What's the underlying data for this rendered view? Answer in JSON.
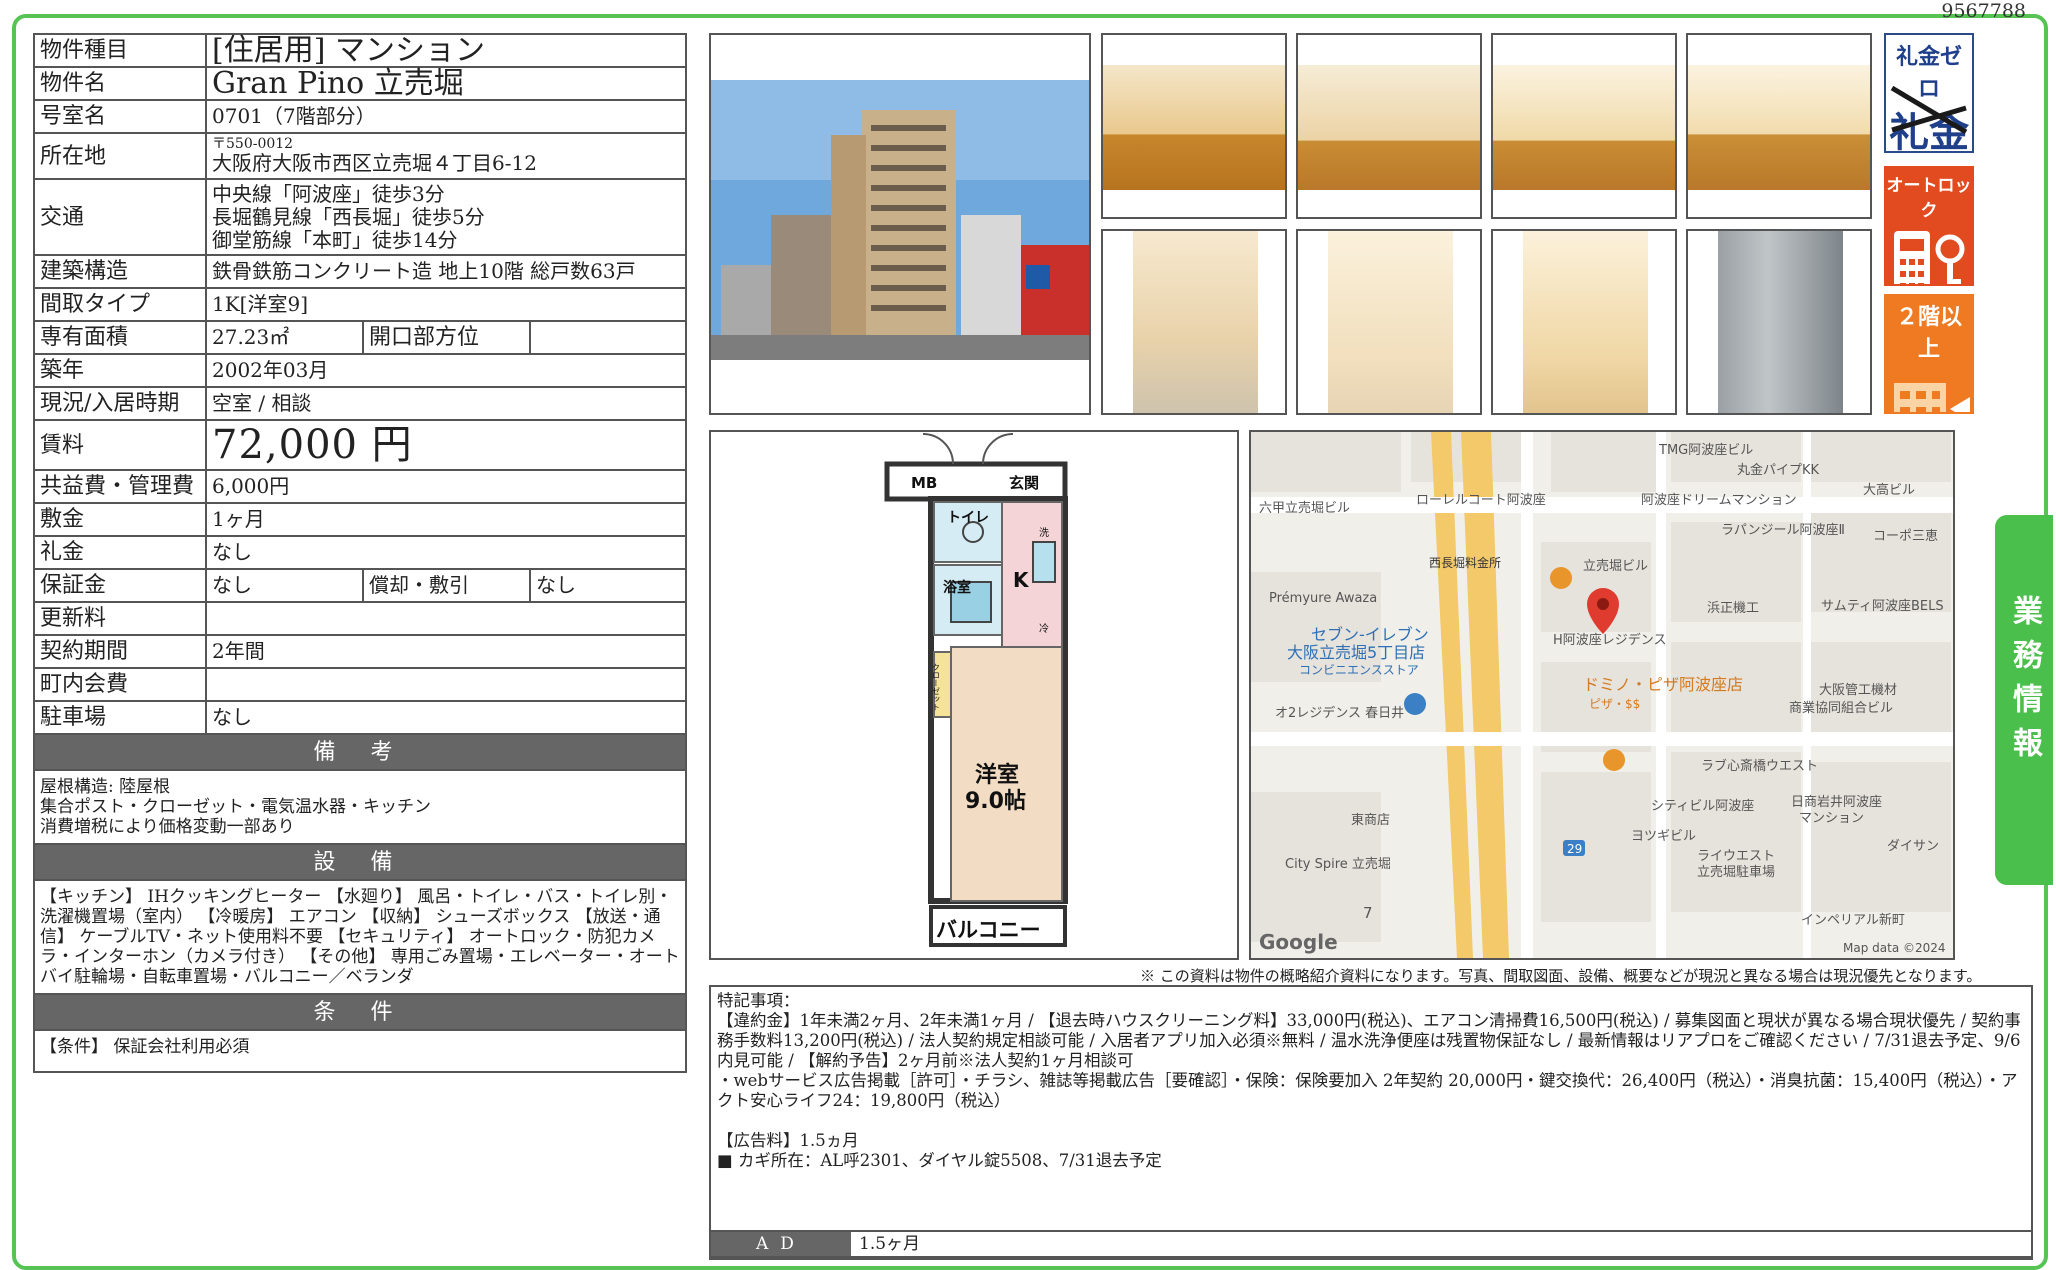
{
  "doc_number": "9567788",
  "property": {
    "type_label": "物件種目",
    "type_value": "[住居用] マンション",
    "name_label": "物件名",
    "name_value": "Gran Pino 立売堀",
    "room_label": "号室名",
    "room_value": "0701（7階部分）",
    "addr_label": "所在地",
    "addr_zip": "〒550-0012",
    "addr_value": "大阪府大阪市西区立売堀４丁目6-12",
    "access_label": "交通",
    "access": [
      "中央線「阿波座」徒歩3分",
      "長堀鶴見線「西長堀」徒歩5分",
      "御堂筋線「本町」徒歩14分"
    ],
    "structure_label": "建築構造",
    "structure_value": "鉄骨鉄筋コンクリート造 地上10階 総戸数63戸",
    "layout_label": "間取タイプ",
    "layout_value": "1K[洋室9]",
    "area_label": "専有面積",
    "area_value": "27.23㎡",
    "opening_label": "開口部方位",
    "opening_value": "",
    "built_label": "築年",
    "built_value": "2002年03月",
    "status_label": "現況/入居時期",
    "status_value": "空室 / 相談",
    "rent_label": "賃料",
    "rent_value": "72,000 円",
    "fee_label": "共益費・管理費",
    "fee_value": "6,000円",
    "deposit_label": "敷金",
    "deposit_value": "1ヶ月",
    "key_money_label": "礼金",
    "key_money_value": "なし",
    "guarantee_label": "保証金",
    "guarantee_value": "なし",
    "amort_label": "償却・敷引",
    "amort_value": "なし",
    "renewal_label": "更新料",
    "renewal_value": "",
    "term_label": "契約期間",
    "term_value": "2年間",
    "community_label": "町内会費",
    "community_value": "",
    "parking_label": "駐車場",
    "parking_value": "なし"
  },
  "remarks": {
    "title": "備 考",
    "lines": [
      "屋根構造: 陸屋根",
      "集合ポスト・クローゼット・電気温水器・キッチン",
      "消費増税により価格変動一部あり"
    ]
  },
  "facilities": {
    "title": "設 備",
    "text": "【キッチン】 IHクッキングヒーター 【水廻り】 風呂・トイレ・バス・トイレ別・洗濯機置場（室内） 【冷暖房】 エアコン 【収納】 シューズボックス 【放送・通信】 ケーブルTV・ネット使用料不要 【セキュリティ】 オートロック・防犯カメラ・インターホン（カメラ付き） 【その他】 専用ごみ置場・エレベーター・オートバイ駐輪場・自転車置場・バルコニー／ベランダ"
  },
  "conditions": {
    "title": "条 件",
    "text": "【条件】 保証会社利用必須"
  },
  "badges": {
    "zero": "礼金ゼロ",
    "zero_strike": "礼金",
    "autolock": "オートロック",
    "floor": "２階以上"
  },
  "side_tab": "業務情報",
  "floorplan": {
    "mb": "MB",
    "entrance": "玄関",
    "toilet": "トイレ",
    "bath": "浴室",
    "k": "K",
    "room": "洋室",
    "size": "9.0帖",
    "closet": "クローゼット",
    "balcony": "バルコニー",
    "fridge": "冷",
    "washer": "洗"
  },
  "map": {
    "labels": [
      "TMG阿波座ビル",
      "丸金パイプKK",
      "大高ビル",
      "六甲立売堀ビル",
      "ローレルコート阿波座",
      "阿波座ドリームマンション",
      "ラパンジール阿波座Ⅱ",
      "コーポ三恵",
      "西長堀料金所",
      "立売堀ビル",
      "Prémyure Awaza",
      "浜正機工",
      "サムティ阿波座BELS",
      "セブン-イレブン",
      "大阪立売堀5丁目店",
      "コンビニエンスストア",
      "H阿波座レジデンス",
      "大阪管工機材",
      "商業協同組合ビル",
      "ドミノ・ピザ阿波座店",
      "ピザ・$$",
      "オ2レジデンス 春日井",
      "ラブ心斎橋ウエスト",
      "シティビル阿波座",
      "日商岩井阿波座",
      "マンション",
      "東商店",
      "ヨツギビル",
      "ダイサン",
      "City Spire 立売堀",
      "ライウエスト",
      "立売堀駐車場",
      "インペリアル新町",
      "Google",
      "Map data ©2024",
      "29",
      "7"
    ]
  },
  "disclaimer": "※ この資料は物件の概略紹介資料になります。写真、間取図面、設備、概要などが現況と異なる場合は現況優先となります。",
  "notes": {
    "header": "特記事項：",
    "lines": [
      "【違約金】1年未満2ヶ月、2年未満1ヶ月 / 【退去時ハウスクリーニング料】33,000円(税込)、エアコン清掃費16,500円(税込) / 募集図面と現状が異なる場合現状優先 / 契約事務手数料13,200円(税込) / 法人契約規定相談可能 / 入居者アプリ加入必須※無料 / 温水洗浄便座は残置物保証なし / 最新情報はリアプロをご確認ください / 7/31退去予定、9/6内見可能 / 【解約予告】2ヶ月前※法人契約1ヶ月相談可",
      "・webサービス広告掲載［許可］・チラシ、雑誌等掲載広告［要確認］・保険：保険要加入 2年契約 20,000円・鍵交換代：26,400円（税込）・消臭抗菌：15,400円（税込）・アクト安心ライフ24：19,800円（税込）",
      "",
      "【広告料】1.5ヵ月",
      "■ カギ所在：AL呼2301、ダイヤル錠5508、7/31退去予定"
    ]
  },
  "ad": {
    "label": "AD",
    "value": "1.5ヶ月"
  }
}
